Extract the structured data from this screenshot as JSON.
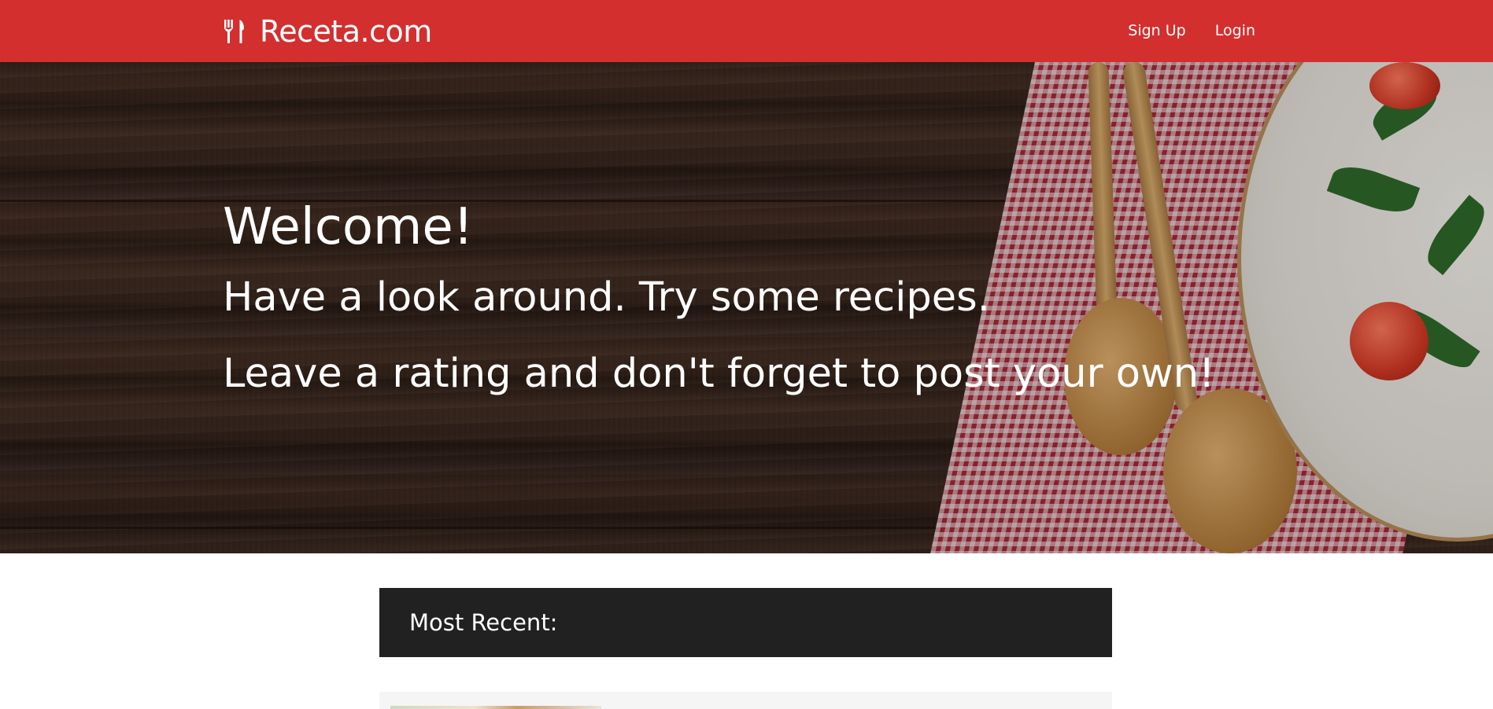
{
  "navbar": {
    "brand_icon": "fork-knife-icon",
    "brand": "Receta.com",
    "links": [
      "Sign Up",
      "Login"
    ],
    "background_color": "#d32f2f"
  },
  "hero": {
    "title": "Welcome!",
    "line1": "Have a look around. Try some recipes.",
    "line2": "Leave a rating and don't forget to post your own!"
  },
  "recent": {
    "title": "Most Recent:",
    "header_color": "#212121"
  }
}
